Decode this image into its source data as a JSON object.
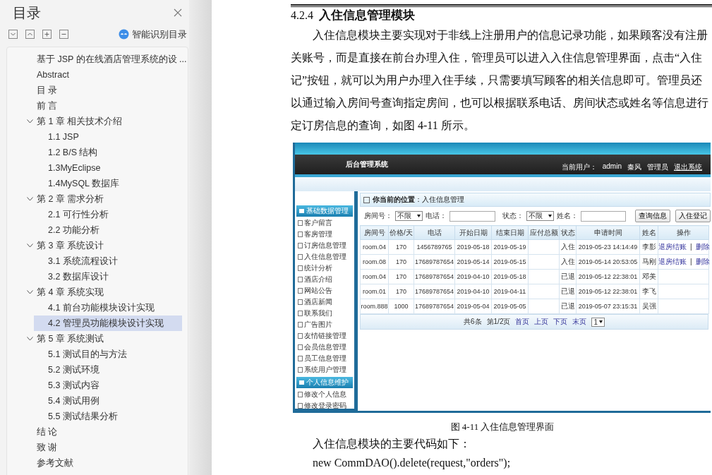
{
  "toc": {
    "title": "目录",
    "smart_button": "智能识别目录",
    "items": [
      {
        "label": "基于 JSP 的在线酒店管理系统的设 ...",
        "selected": false
      },
      {
        "label": "Abstract",
        "selected": false
      },
      {
        "label": "目 录",
        "selected": false
      },
      {
        "label": "前 言",
        "selected": false
      },
      {
        "label": "第 1 章 相关技术介绍",
        "selected": false,
        "expanded": true,
        "children": [
          {
            "label": "1.1 JSP",
            "selected": false
          },
          {
            "label": "1.2  B/S 结构",
            "selected": false
          },
          {
            "label": "1.3MyEclipse",
            "selected": false
          },
          {
            "label": "1.4MySQL 数据库",
            "selected": false
          }
        ]
      },
      {
        "label": "第 2 章 需求分析",
        "selected": false,
        "expanded": true,
        "children": [
          {
            "label": "2.1 可行性分析",
            "selected": false
          },
          {
            "label": "2.2 功能分析",
            "selected": false
          }
        ]
      },
      {
        "label": "第 3 章 系统设计",
        "selected": false,
        "expanded": true,
        "children": [
          {
            "label": "3.1 系统流程设计",
            "selected": false
          },
          {
            "label": "3.2 数据库设计",
            "selected": false
          }
        ]
      },
      {
        "label": "第 4 章 系统实现",
        "selected": false,
        "expanded": true,
        "children": [
          {
            "label": "4.1  前台功能模块设计实现",
            "selected": false
          },
          {
            "label": "4.2  管理员功能模块设计实现",
            "selected": true
          }
        ]
      },
      {
        "label": "第 5 章 系统测试",
        "selected": false,
        "expanded": true,
        "children": [
          {
            "label": "5.1 测试目的与方法",
            "selected": false
          },
          {
            "label": "5.2 测试环境",
            "selected": false
          },
          {
            "label": "5.3 测试内容",
            "selected": false
          },
          {
            "label": "5.4 测试用例",
            "selected": false
          },
          {
            "label": "5.5 测试结果分析",
            "selected": false
          }
        ]
      },
      {
        "label": "结 论",
        "selected": false
      },
      {
        "label": "致 谢",
        "selected": false
      },
      {
        "label": "参考文献",
        "selected": false
      }
    ]
  },
  "document": {
    "heading_number": "4.2.4",
    "heading_title": "入住信息管理模块",
    "paragraph_lines": [
      "入住信息模块主要实现对于非线上注册用户的信息记录功能，如果顾客没有注册",
      "关账号，而是直接在前台办理入住，管理员可以进入入住信息管理界面，点击“入住",
      "记”按钮，就可以为用户办理入住手续，只需要填写顾客的相关信息即可。管理员还",
      "以通过输入房间号查询指定房间，也可以根据联系电话、房间状态或姓名等信息进行",
      "定订房信息的查询，如图 4-11 所示。"
    ],
    "figure": {
      "app_title": "后台管理系统",
      "user_bar": [
        "当前用户：",
        "admin",
        "秦风",
        "管理员"
      ],
      "logout": "退出系统",
      "nav_groups": [
        {
          "title": "基础数据管理",
          "items": [
            "客户留言",
            "客房管理",
            "订房信息管理",
            "入住信息管理",
            "统计分析",
            "酒店介绍",
            "网站公告",
            "酒店新闻",
            "联系我们",
            "广告图片",
            "友情链接管理",
            "会员信息管理",
            "员工信息管理",
            "系统用户管理"
          ]
        },
        {
          "title": "个人信息维护",
          "items": [
            "修改个人信息",
            "修改登录密码"
          ]
        }
      ],
      "breadcrumb": "**你当前的位置**：入住信息管理",
      "filters": [
        {
          "kind": "select",
          "label": "房间号：",
          "value": "不限"
        },
        {
          "kind": "text",
          "label": "电话："
        },
        {
          "kind": "select",
          "label": "状态：",
          "value": "不限"
        },
        {
          "kind": "text",
          "label": "姓名："
        }
      ],
      "buttons": [
        "查询信息",
        "入住登记"
      ],
      "columns": [
        "房间号",
        "价格/天",
        "电话",
        "开始日期",
        "结束日期",
        "应付总额",
        "状态",
        "申请时间",
        "姓名",
        "操作"
      ],
      "rows": [
        {
          "room": "room.04",
          "price": "170",
          "phone": "1456789765",
          "start": "2019-05-18",
          "end": "2019-05-19",
          "status": "入住",
          "applied": "2019-05-23 14:14:49",
          "name": "李影",
          "actions": [
            "退房结账",
            "删除"
          ]
        },
        {
          "room": "room.08",
          "price": "170",
          "phone": "17689787654",
          "start": "2019-05-14",
          "end": "2019-05-15",
          "status": "入住",
          "applied": "2019-05-14 20:53:05",
          "name": "马刚",
          "actions": [
            "退房结账",
            "删除"
          ]
        },
        {
          "room": "room.04",
          "price": "170",
          "phone": "17689787654",
          "start": "2019-04-10",
          "end": "2019-05-18",
          "status": "已退",
          "applied": "2019-05-12 22:38:01",
          "name": "邓美"
        },
        {
          "room": "room.01",
          "price": "170",
          "phone": "17689787654",
          "start": "2019-04-10",
          "end": "2019-04-11",
          "status": "已退",
          "applied": "2019-05-12 22:38:01",
          "name": "李飞"
        },
        {
          "room": "room.888",
          "price": "1000",
          "phone": "17689787654",
          "start": "2019-05-04",
          "end": "2019-05-05",
          "status": "已退",
          "applied": "2019-05-07 23:15:31",
          "name": "吴强"
        }
      ],
      "action_separator": "|",
      "pager": {
        "summary": "共6条",
        "page": "第1/2页",
        "links": [
          "首页",
          "上页",
          "下页",
          "末页"
        ],
        "page_select": "1"
      }
    },
    "caption": "图 4-11 入住信息管理界面",
    "code_intro": "入住信息模块的主要代码如下：",
    "code_line": "new CommDAO().delete(request,\"orders\");"
  }
}
